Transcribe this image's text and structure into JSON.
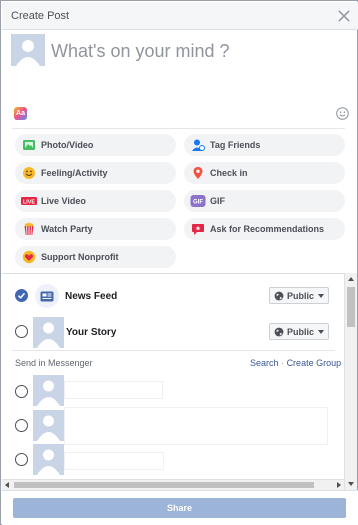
{
  "dialog": {
    "title": "Create Post",
    "close_icon": "close-icon"
  },
  "composer": {
    "placeholder": "What's on your mind ?"
  },
  "actions": [
    {
      "label": "Photo/Video",
      "icon": "photo-video-icon"
    },
    {
      "label": "Tag Friends",
      "icon": "tag-friends-icon"
    },
    {
      "label": "Feeling/Activity",
      "icon": "feeling-icon"
    },
    {
      "label": "Check in",
      "icon": "check-in-icon"
    },
    {
      "label": "Live Video",
      "icon": "live-video-icon",
      "badge": "LIVE"
    },
    {
      "label": "GIF",
      "icon": "gif-icon",
      "badge": "GIF"
    },
    {
      "label": "Watch Party",
      "icon": "watch-party-icon"
    },
    {
      "label": "Ask for Recommendations",
      "icon": "recommendations-icon"
    },
    {
      "label": "Support Nonprofit",
      "icon": "nonprofit-icon"
    }
  ],
  "audience": {
    "news_feed": {
      "label": "News Feed",
      "checked": true,
      "privacy": "Public"
    },
    "story": {
      "label": "Your Story",
      "checked": false,
      "privacy": "Public"
    }
  },
  "messenger": {
    "label": "Send in Messenger",
    "search_link": "Search",
    "separator": "·",
    "create_group_link": "Create Group"
  },
  "footer": {
    "share_label": "Share"
  },
  "colors": {
    "accent": "#4267b2",
    "share_disabled": "#9cb4d8",
    "link": "#385898"
  }
}
